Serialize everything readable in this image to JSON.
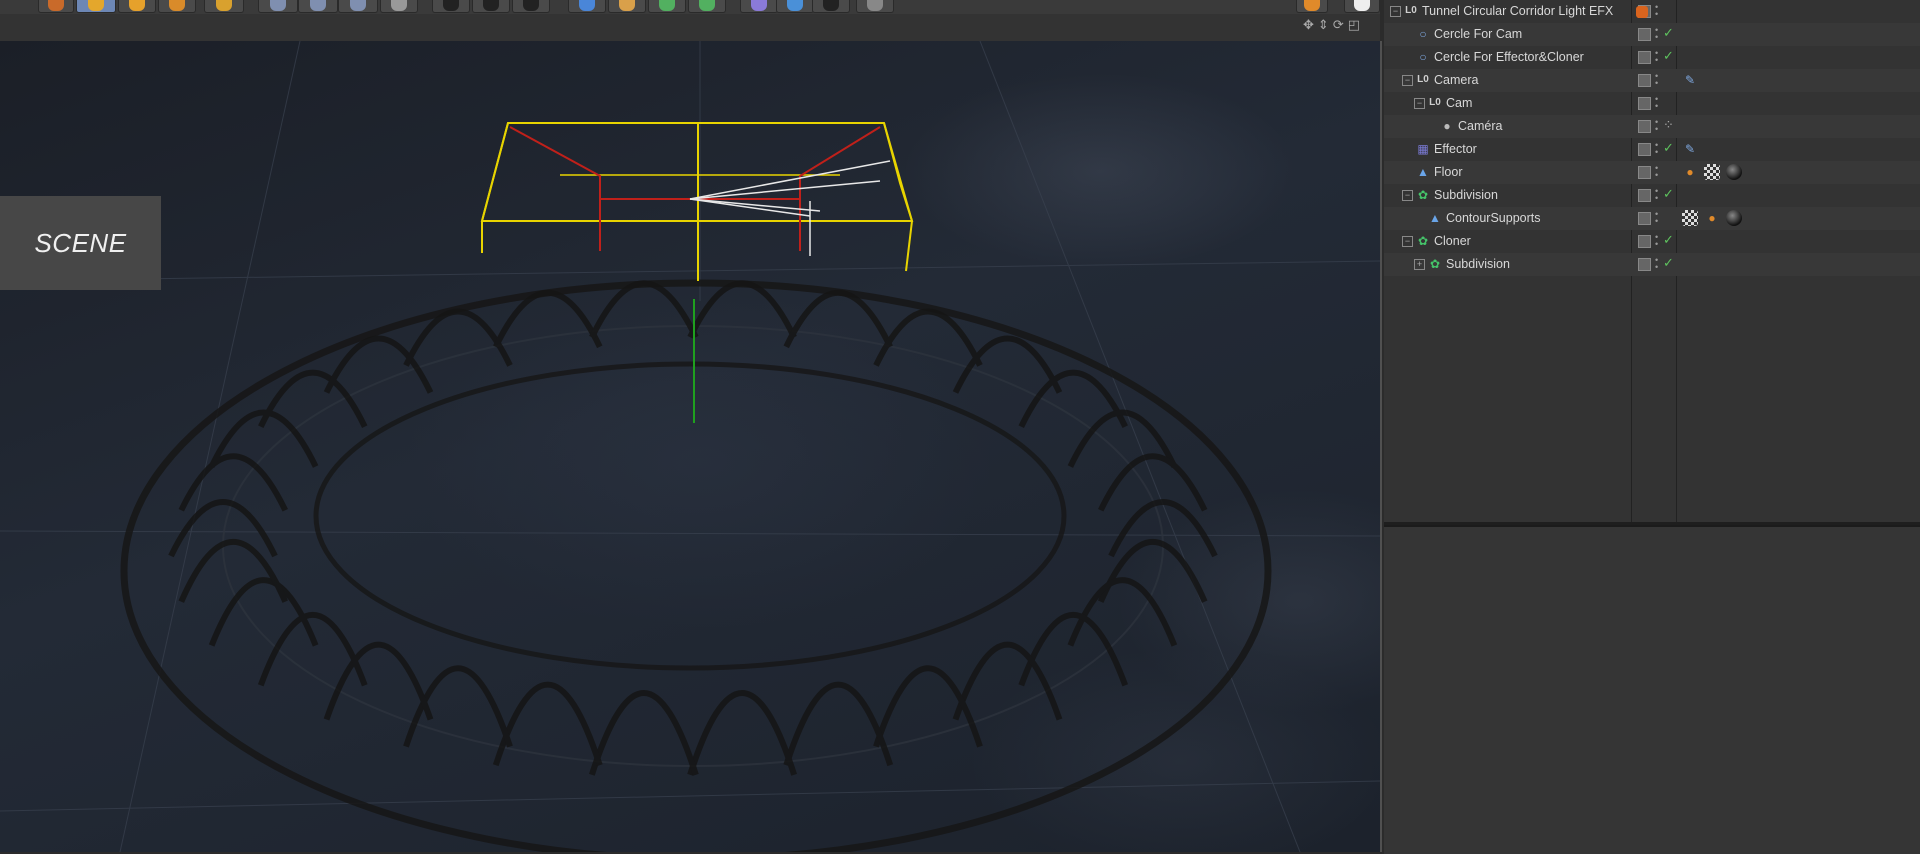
{
  "app": {
    "toolbar_label": "Cinema 4D toolbar"
  },
  "viewport": {
    "overlay_label": "SCENE"
  },
  "object_manager": {
    "rows": [
      {
        "name": "Tunnel Circular Corridor Light EFX",
        "icon": "null-object-icon",
        "check": false
      },
      {
        "name": "Cercle For Cam",
        "icon": "circle-spline-icon",
        "check": true
      },
      {
        "name": "Cercle For Effector&Cloner",
        "icon": "circle-spline-icon",
        "check": true
      },
      {
        "name": "Camera",
        "icon": "null-object-icon",
        "check": false
      },
      {
        "name": "Cam",
        "icon": "null-object-icon",
        "check": false
      },
      {
        "name": "Caméra",
        "icon": "camera-icon",
        "check": false
      },
      {
        "name": "Effector",
        "icon": "effector-icon",
        "check": true
      },
      {
        "name": "Floor",
        "icon": "floor-icon",
        "check": false
      },
      {
        "name": "Subdivision",
        "icon": "subdivision-icon",
        "check": true
      },
      {
        "name": "ContourSupports",
        "icon": "polygon-object-icon",
        "check": false
      },
      {
        "name": "Cloner",
        "icon": "cloner-icon",
        "check": true
      },
      {
        "name": "Subdivision",
        "icon": "subdivision-icon",
        "check": true
      }
    ]
  },
  "colors": {
    "check": "#5ec25e",
    "selection_yellow": "#e8d400",
    "accent_orange": "#d9641e"
  }
}
